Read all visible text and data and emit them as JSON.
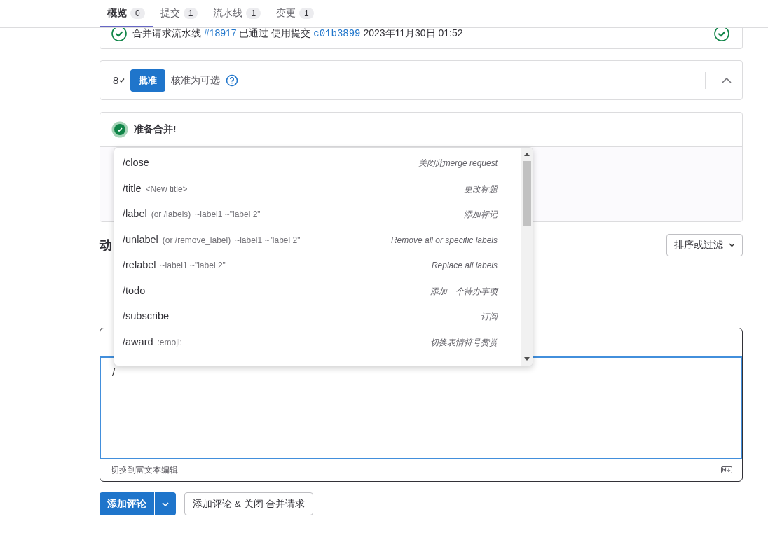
{
  "tabs": [
    {
      "label": "概览",
      "count": "0",
      "selected": true
    },
    {
      "label": "提交",
      "count": "1",
      "selected": false
    },
    {
      "label": "流水线",
      "count": "1",
      "selected": false
    },
    {
      "label": "变更",
      "count": "1",
      "selected": false
    }
  ],
  "pipeline": {
    "text_before": "合并请求流水线",
    "pipeline_link": "#18917",
    "text_mid": "已通过 使用提交",
    "commit_link": "c01b3899",
    "date": "2023年11月30日 01:52"
  },
  "approval": {
    "approvers_count": "8",
    "approve_button": "批准",
    "status": "核准为可选",
    "expanded": true
  },
  "merge": {
    "status": "准备合并!"
  },
  "activity": {
    "heading": "动",
    "sort_button": "排序或过滤"
  },
  "comment": {
    "value": "/",
    "switch_label": "切换到富文本编辑",
    "submit": "添加评论",
    "close_button": "添加评论 & 关闭 合并请求"
  },
  "autocomplete": {
    "items": [
      {
        "command": "/close",
        "description": "关闭此merge request"
      },
      {
        "command": "/title",
        "params": [
          "<New title>"
        ],
        "description": "更改标题"
      },
      {
        "command": "/label",
        "params": [
          "(or /labels)",
          "~label1 ~\"label 2\""
        ],
        "description": "添加标记"
      },
      {
        "command": "/unlabel",
        "params": [
          "(or /remove_label)",
          "~label1 ~\"label 2\""
        ],
        "description": "Remove all or specific labels"
      },
      {
        "command": "/relabel",
        "params": [
          "~label1 ~\"label 2\""
        ],
        "description": "Replace all labels"
      },
      {
        "command": "/todo",
        "description": "添加一个待办事项"
      },
      {
        "command": "/subscribe",
        "description": "订阅"
      },
      {
        "command": "/award",
        "params": [
          ":emoji:"
        ],
        "description": "切换表情符号赞赏"
      }
    ]
  }
}
